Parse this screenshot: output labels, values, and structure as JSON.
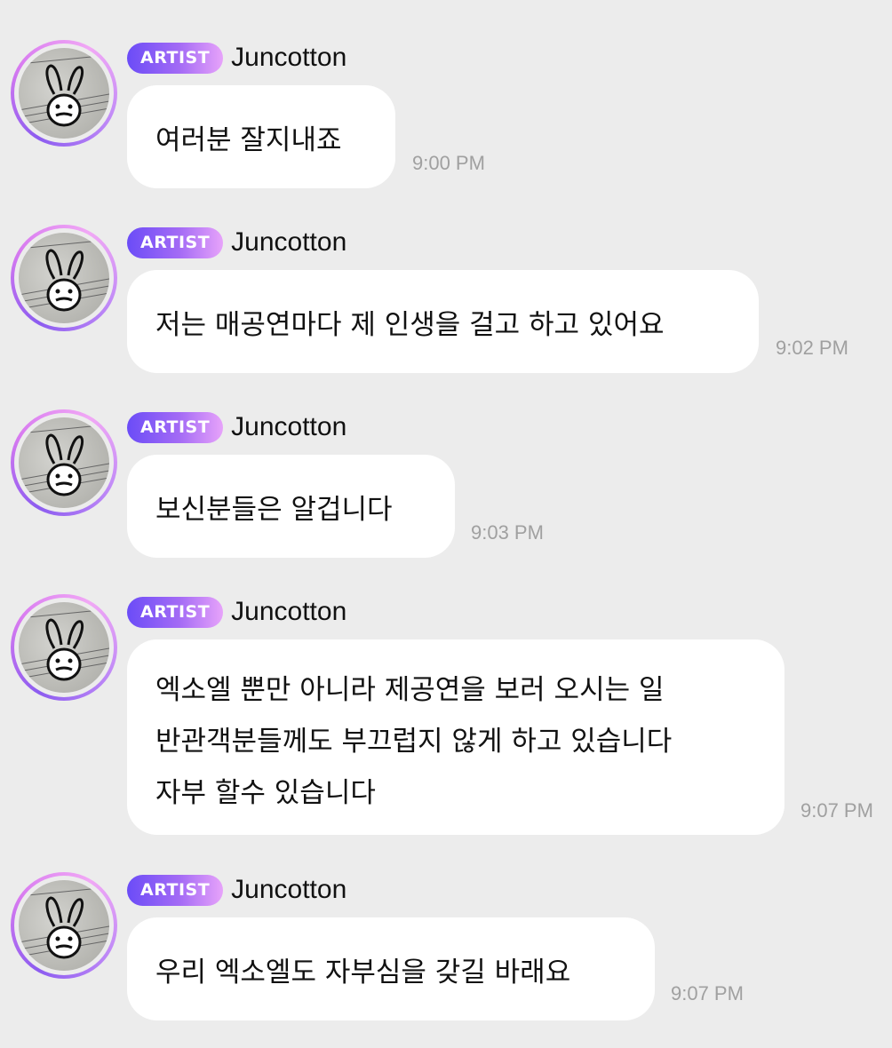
{
  "messages": [
    {
      "badge": "ARTIST",
      "name": "Juncotton",
      "lines": [
        "여러분 잘지내죠"
      ],
      "time": "9:00 PM"
    },
    {
      "badge": "ARTIST",
      "name": "Juncotton",
      "lines": [
        "저는 매공연마다 제 인생을 걸고 하고 있어요"
      ],
      "time": "9:02 PM"
    },
    {
      "badge": "ARTIST",
      "name": "Juncotton",
      "lines": [
        "보신분들은 알겁니다"
      ],
      "time": "9:03 PM"
    },
    {
      "badge": "ARTIST",
      "name": "Juncotton",
      "lines": [
        "엑소엘 뿐만 아니라 제공연을 보러 오시는 일",
        "반관객분들께도 부끄럽지 않게 하고 있습니다",
        "자부 할수 있습니다"
      ],
      "time": "9:07 PM"
    },
    {
      "badge": "ARTIST",
      "name": "Juncotton",
      "lines": [
        "우리 엑소엘도 자부심을 갖길 바래요"
      ],
      "time": "9:07 PM"
    }
  ],
  "icons": {
    "avatar": "bunny-doodle-icon"
  },
  "colors": {
    "badge_start": "#6b4cf7",
    "badge_end": "#e7a3fa",
    "bubble": "#ffffff",
    "background": "#ececec",
    "time": "#a0a0a0"
  }
}
